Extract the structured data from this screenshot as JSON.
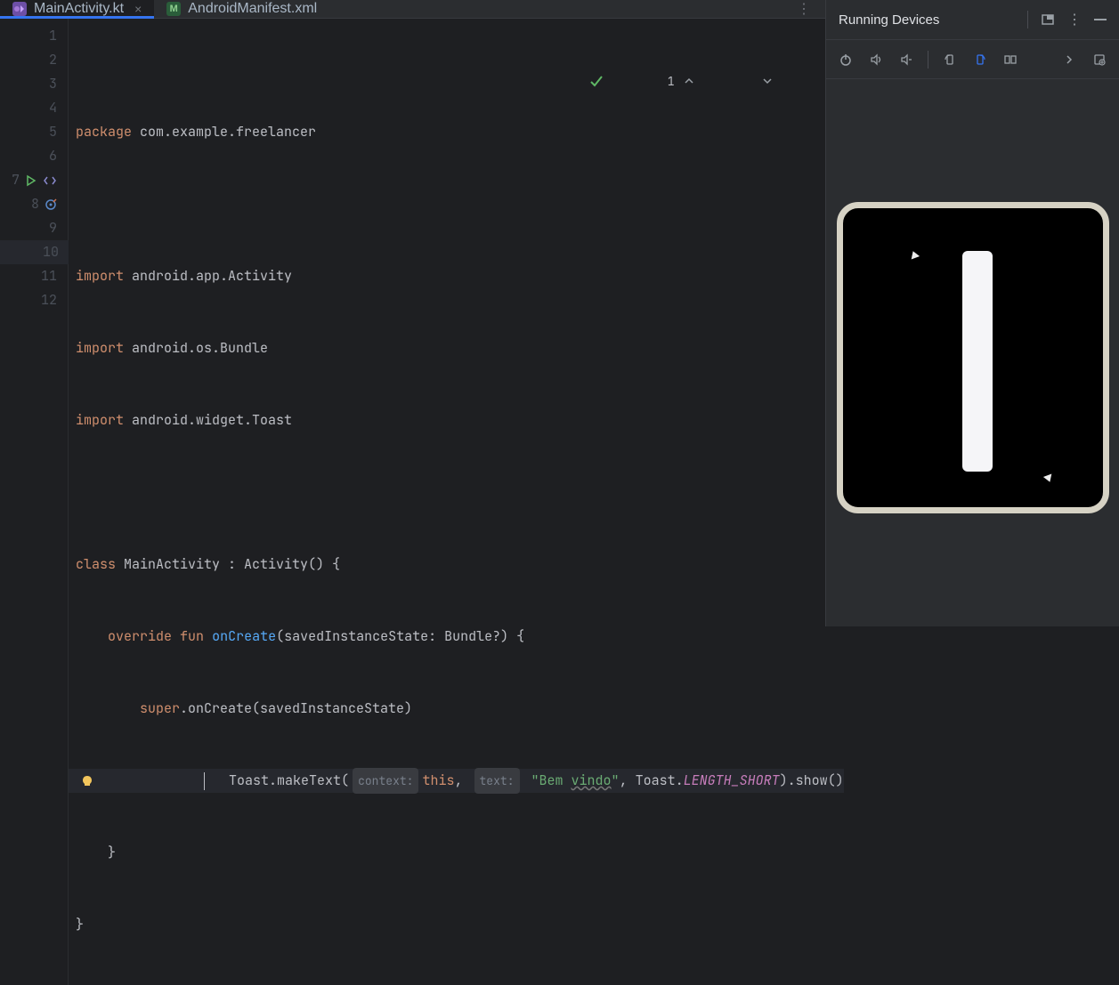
{
  "tabs": [
    {
      "label": "MainActivity.kt",
      "active": true,
      "icon": "kt"
    },
    {
      "label": "AndroidManifest.xml",
      "active": false,
      "icon": "mf"
    }
  ],
  "inspection": {
    "count": "1"
  },
  "code": {
    "l1_kw": "package",
    "l1_pkg": " com.example.freelancer",
    "l3_kw": "import",
    "l3_imp": " android.app.Activity",
    "l4_kw": "import",
    "l4_imp": " android.os.Bundle",
    "l5_kw": "import",
    "l5_imp": " android.widget.Toast",
    "l7_kw": "class",
    "l7_rest": " MainActivity : Activity() {",
    "l8_ov": "override",
    "l8_fun": "fun",
    "l8_fn": "onCreate",
    "l8_sig": "(savedInstanceState: Bundle?) {",
    "l9_super": "super",
    "l9_rest": ".onCreate(savedInstanceState)",
    "l10_toast": "Toast.makeText(",
    "l10_hint1": "context:",
    "l10_this": "this",
    "l10_comma1": ", ",
    "l10_hint2": "text:",
    "l10_str_open": " \"Bem ",
    "l10_str_und": "vindo",
    "l10_str_close": "\"",
    "l10_comma2": ", Toast.",
    "l10_const": "LENGTH_SHORT",
    "l10_end": ").show()",
    "l11": "    }",
    "l12": "}"
  },
  "line_numbers": [
    "1",
    "2",
    "3",
    "4",
    "5",
    "6",
    "7",
    "8",
    "9",
    "10",
    "11",
    "12"
  ],
  "devices": {
    "title": "Running Devices"
  }
}
